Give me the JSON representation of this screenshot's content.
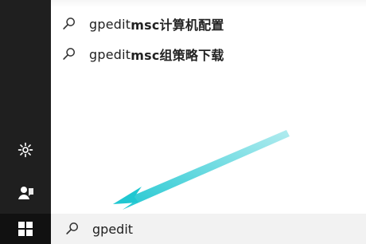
{
  "suggestions": [
    {
      "prefix": "gpedit ",
      "bold": "msc计算机配置"
    },
    {
      "prefix": "gpedit ",
      "bold": "msc组策略下载"
    }
  ],
  "search": {
    "query": "gpedit"
  },
  "icons": {
    "search": "search-icon",
    "settings": "gear-icon",
    "user": "person-icon",
    "start": "windows-icon"
  },
  "colors": {
    "rail": "#1f1f1f",
    "searchbar": "#f2f2f2",
    "arrow": "#2ecfd1"
  }
}
